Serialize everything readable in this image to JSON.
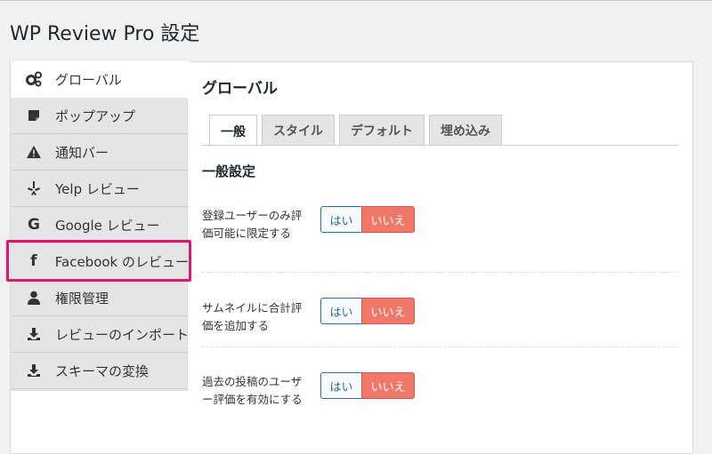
{
  "page": {
    "title": "WP Review Pro 設定"
  },
  "sidebar": {
    "items": [
      {
        "label": "グローバル",
        "icon": "gears-icon",
        "active": true
      },
      {
        "label": "ポップアップ",
        "icon": "popup-icon"
      },
      {
        "label": "通知バー",
        "icon": "warning-icon"
      },
      {
        "label": "Yelp レビュー",
        "icon": "yelp-icon"
      },
      {
        "label": "Google レビュー",
        "icon": "google-icon"
      },
      {
        "label": "Facebook のレビュー",
        "icon": "facebook-icon",
        "highlighted": true
      },
      {
        "label": "権限管理",
        "icon": "user-icon"
      },
      {
        "label": "レビューのインポート",
        "icon": "download-icon"
      },
      {
        "label": "スキーマの変換",
        "icon": "download-icon"
      }
    ]
  },
  "main": {
    "title": "グローバル",
    "tabs": [
      "一般",
      "スタイル",
      "デフォルト",
      "埋め込み"
    ],
    "active_tab": "一般",
    "section_title": "一般設定",
    "settings": [
      {
        "label": "登録ユーザーのみ評価可能に限定する",
        "yes": "はい",
        "no": "いいえ",
        "selected": "いいえ"
      },
      {
        "label": "サムネイルに合計評価を追加する",
        "yes": "はい",
        "no": "いいえ",
        "selected": "いいえ"
      },
      {
        "label": "過去の投稿のユーザー評価を有効にする",
        "yes": "はい",
        "no": "いいえ",
        "selected": "いいえ"
      }
    ]
  },
  "colors": {
    "highlight": "#e5136b",
    "no_active": "#f07869",
    "yes_border": "#2e6da4"
  }
}
